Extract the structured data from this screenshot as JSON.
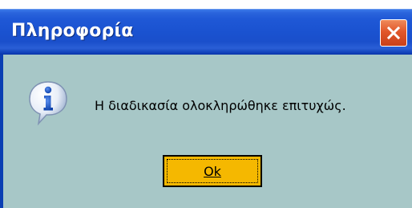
{
  "window": {
    "title": "Πληροφορία"
  },
  "title_bar": {
    "close_icon": "close-icon"
  },
  "dialog": {
    "icon": "info-icon",
    "message": "Η διαδικασία ολοκληρώθηκε επιτυχώς.",
    "ok_label": "Ok"
  },
  "colors": {
    "title_bar": "#1f58d6",
    "close_button": "#e1572a",
    "body_background": "#a7c7c7",
    "ok_button": "#f5b800"
  }
}
